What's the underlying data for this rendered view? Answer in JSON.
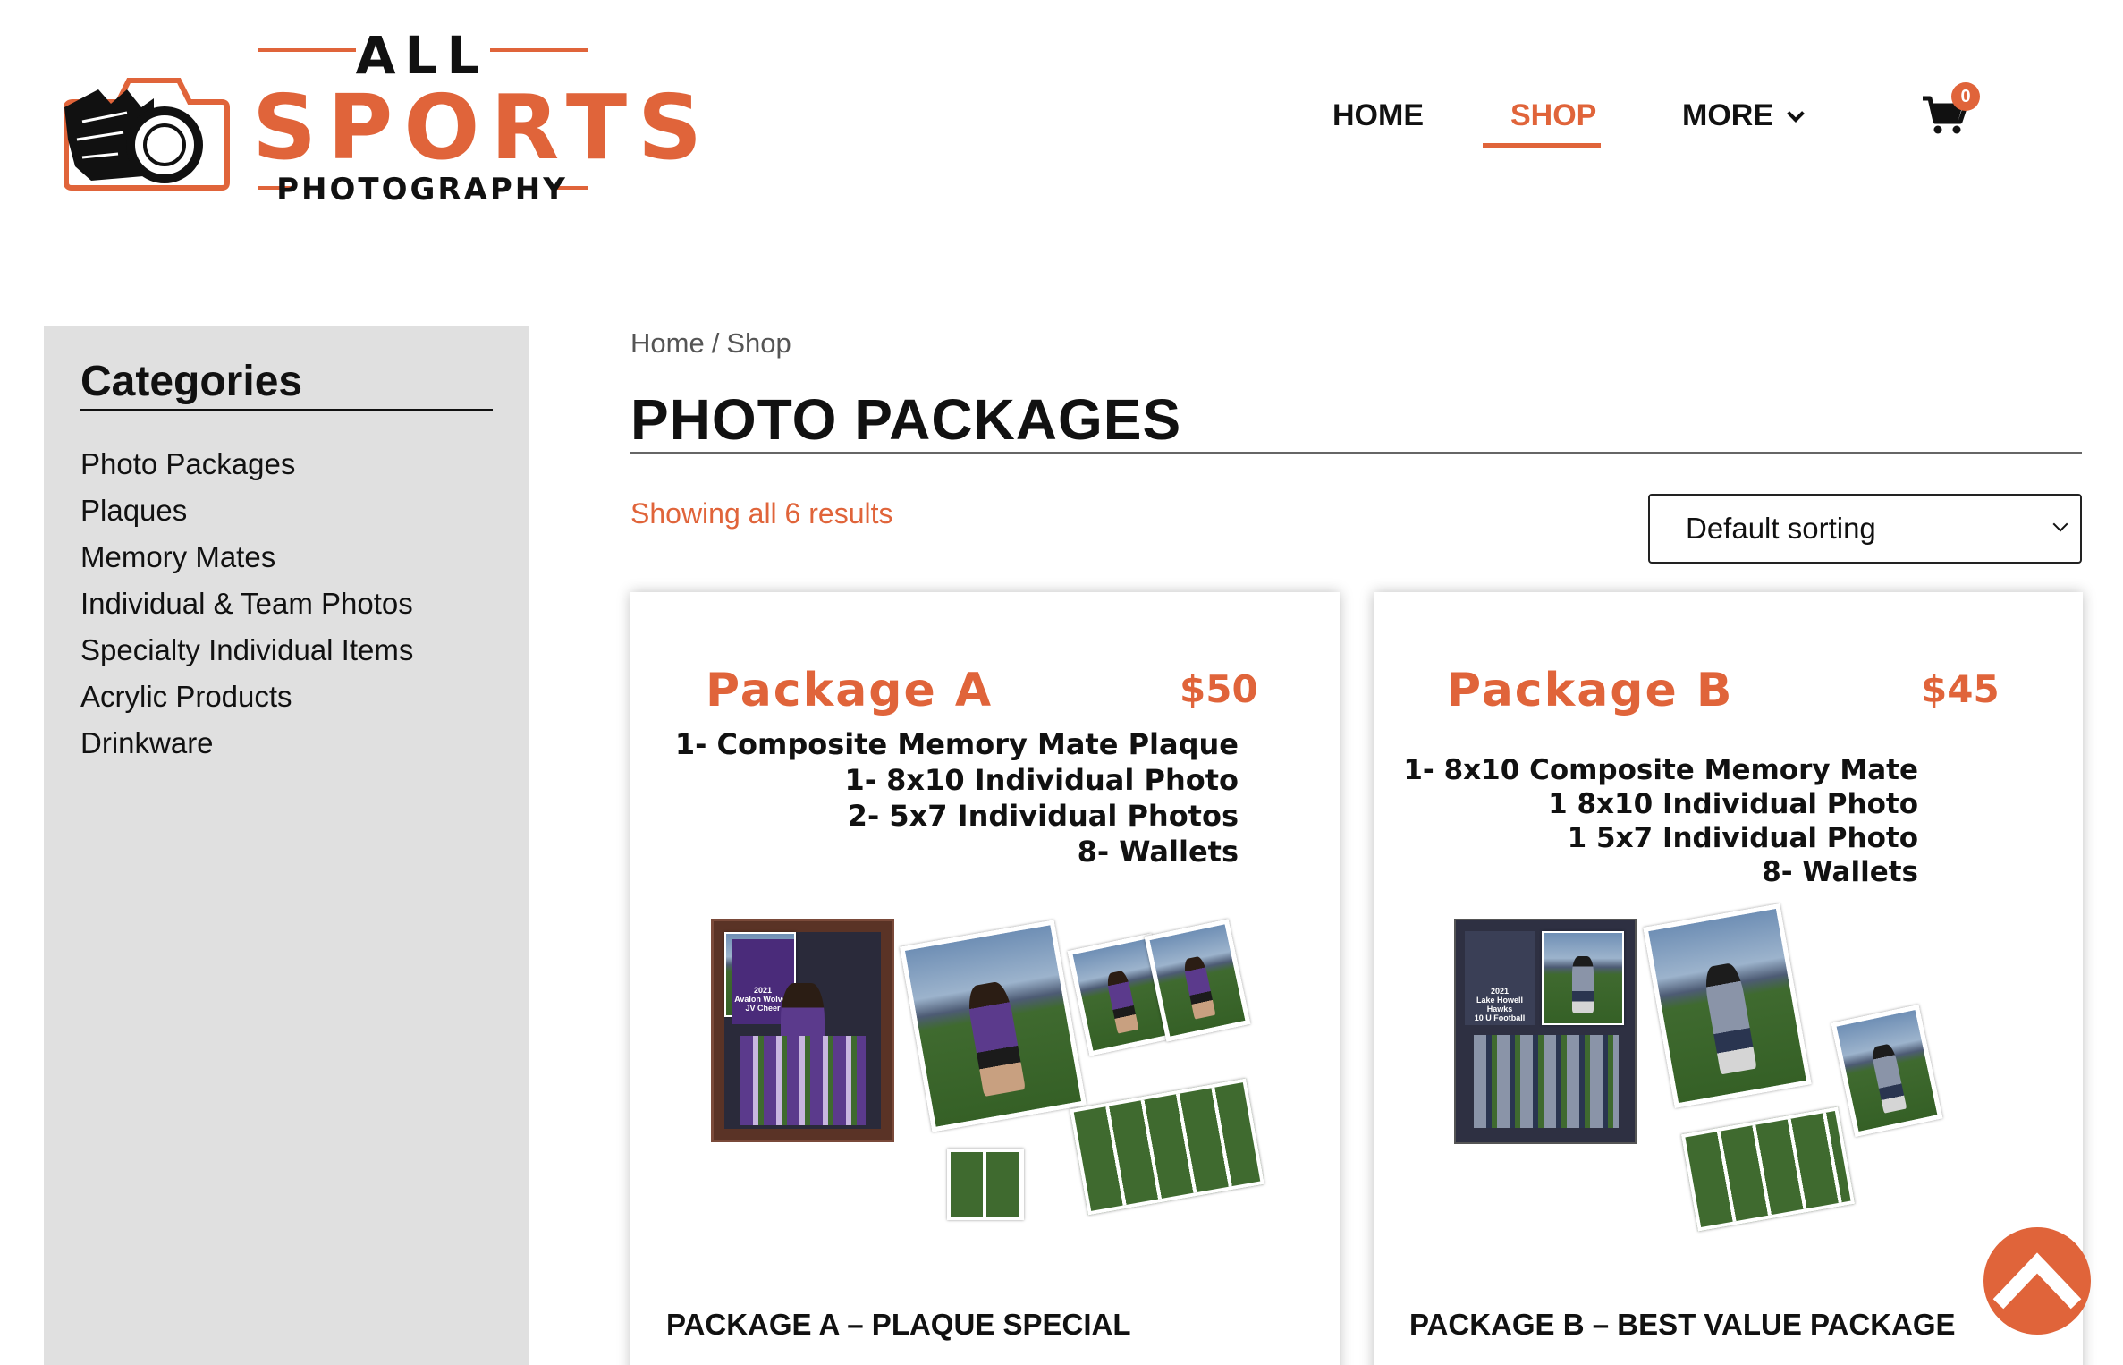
{
  "brand": {
    "line1": "ALL",
    "line2": "SPORTS",
    "line3": "PHOTOGRAPHY",
    "accent_color": "#e0643a"
  },
  "nav": {
    "items": [
      {
        "label": "HOME",
        "active": false
      },
      {
        "label": "SHOP",
        "active": true
      },
      {
        "label": "MORE",
        "active": false,
        "has_dropdown": true
      }
    ],
    "cart_count": "0",
    "cart_icon": "cart-icon"
  },
  "sidebar": {
    "title": "Categories",
    "items": [
      {
        "label": "Photo Packages"
      },
      {
        "label": "Plaques"
      },
      {
        "label": "Memory Mates"
      },
      {
        "label": "Individual & Team Photos"
      },
      {
        "label": "Specialty Individual Items"
      },
      {
        "label": "Acrylic Products"
      },
      {
        "label": "Drinkware"
      }
    ]
  },
  "breadcrumb": {
    "home": "Home",
    "separator": "/",
    "current": "Shop"
  },
  "page": {
    "title": "PHOTO PACKAGES",
    "results_text": "Showing all 6 results"
  },
  "sorting": {
    "selected": "Default sorting"
  },
  "products": [
    {
      "image_title": "Package A",
      "image_price": "$50",
      "image_lines": [
        "1- Composite Memory Mate Plaque",
        "1- 8x10 Individual Photo",
        "2- 5x7 Individual Photos",
        "8- Wallets"
      ],
      "image_text": {
        "year": "2021",
        "team": "Avalon Wolves",
        "squad": "JV Cheer"
      },
      "name": "PACKAGE A – PLAQUE SPECIAL"
    },
    {
      "image_title": "Package B",
      "image_price": "$45",
      "image_lines": [
        "1- 8x10 Composite Memory Mate",
        "1 8x10 Individual Photo",
        "1 5x7 Individual Photo",
        "8- Wallets"
      ],
      "image_text": {
        "year": "2021",
        "team": "Lake Howell Hawks",
        "squad": "10 U Football"
      },
      "name": "PACKAGE B – BEST VALUE PACKAGE"
    }
  ],
  "scroll_top_icon": "chevron-up-icon"
}
